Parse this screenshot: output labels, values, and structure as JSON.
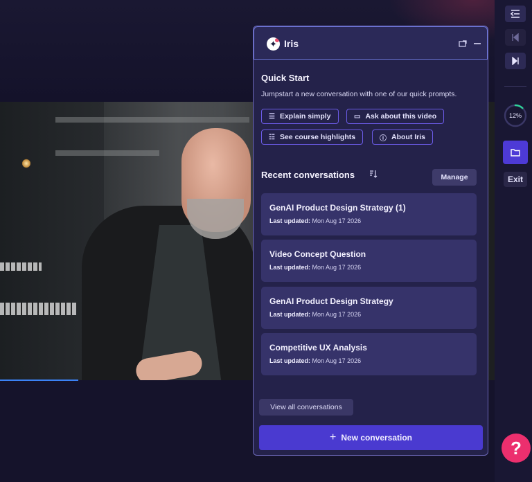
{
  "panel": {
    "title": "Iris",
    "quick_start": {
      "heading": "Quick Start",
      "description": "Jumpstart a new conversation with one of our quick prompts.",
      "prompts": [
        {
          "label": "Explain simply",
          "icon": "list-icon"
        },
        {
          "label": "Ask about this video",
          "icon": "chat-icon"
        },
        {
          "label": "See course highlights",
          "icon": "list-check-icon"
        },
        {
          "label": "About Iris",
          "icon": "help-circle-icon"
        }
      ]
    },
    "recent": {
      "heading": "Recent conversations",
      "manage_label": "Manage",
      "conversations": [
        {
          "title": "GenAI Product Design Strategy (1)",
          "updated_label": "Last updated:",
          "updated_value": "Mon Aug 17 2026"
        },
        {
          "title": "Video Concept Question",
          "updated_label": "Last updated:",
          "updated_value": "Mon Aug 17 2026"
        },
        {
          "title": "GenAI Product Design Strategy",
          "updated_label": "Last updated:",
          "updated_value": "Mon Aug 17 2026"
        },
        {
          "title": "Competitive UX Analysis",
          "updated_label": "Last updated:",
          "updated_value": "Mon Aug 17 2026"
        }
      ]
    },
    "view_all_label": "View all conversations",
    "new_conversation_label": "New conversation"
  },
  "rail": {
    "progress": "12%",
    "progress_value": 0.12,
    "exit_label": "Exit",
    "help_label": "?"
  },
  "colors": {
    "accent": "#4a3ad0",
    "help": "#ec2f6e",
    "panel_bg": "#24224a",
    "card_bg": "#36336a"
  }
}
